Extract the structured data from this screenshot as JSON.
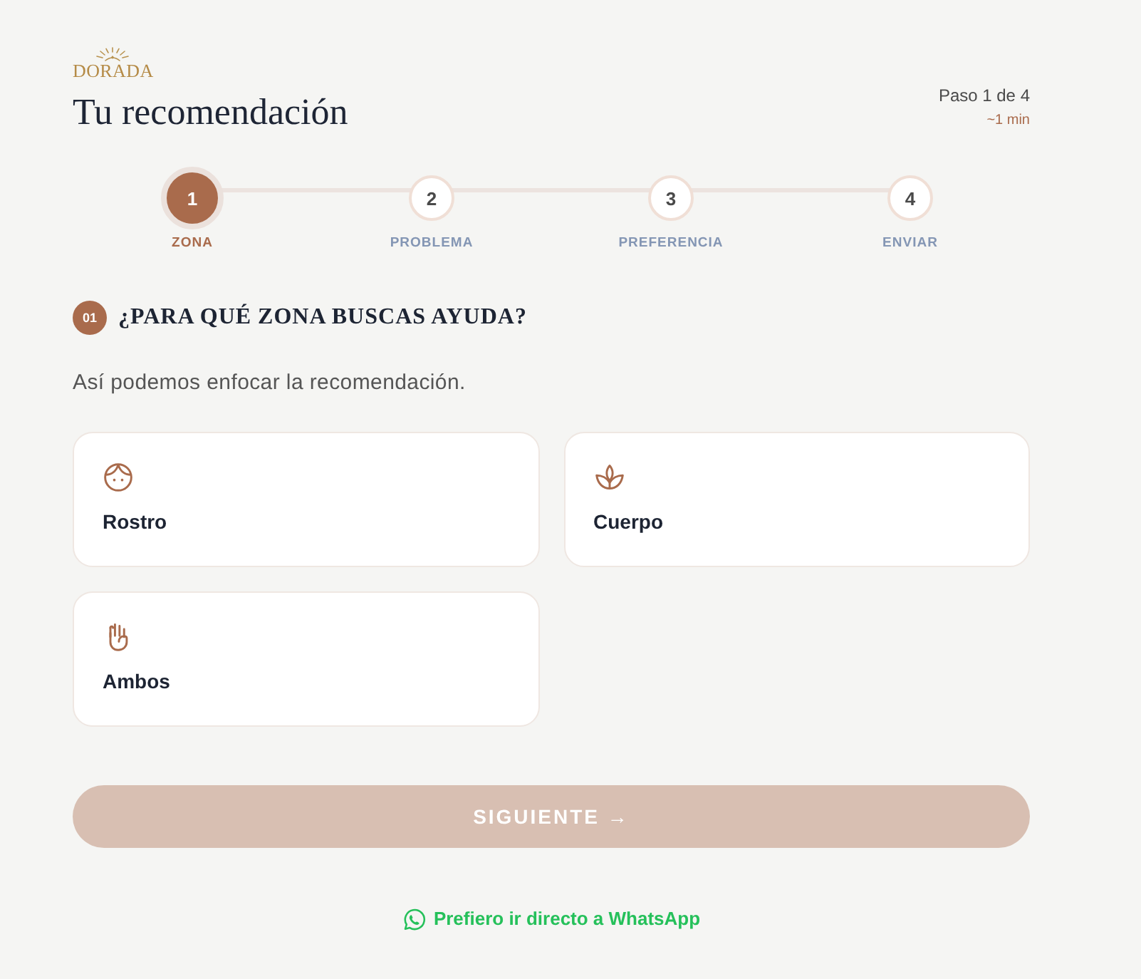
{
  "brand": {
    "logo_text": "DORADA"
  },
  "header": {
    "title": "Tu recomendación",
    "step_counter": "Paso 1 de 4",
    "duration": "~1 min"
  },
  "stepper": {
    "steps": [
      {
        "number": "1",
        "label": "ZONA",
        "selected": true
      },
      {
        "number": "2",
        "label": "PROBLEMA",
        "selected": false
      },
      {
        "number": "3",
        "label": "PREFERENCIA",
        "selected": false
      },
      {
        "number": "4",
        "label": "ENVIAR",
        "selected": false
      }
    ]
  },
  "question": {
    "number": "01",
    "title": "¿PARA QUÉ ZONA BUSCAS AYUDA?",
    "subtitle": "Así podemos enfocar la recomendación.",
    "options": [
      {
        "kind": "face",
        "label": "Rostro",
        "selected": false
      },
      {
        "kind": "lotus",
        "label": "Cuerpo",
        "selected": false
      },
      {
        "kind": "hand",
        "label": "Ambos",
        "selected": false
      }
    ]
  },
  "next_button": {
    "label": "SIGUIENTE →",
    "disabled": true
  },
  "whatsapp_link": {
    "label": "Prefiero ir directo a WhatsApp"
  }
}
